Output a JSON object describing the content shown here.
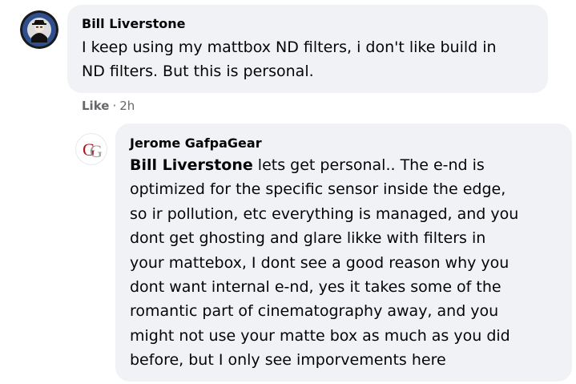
{
  "comment1": {
    "author": "Bill Liverstone",
    "text": "I keep using my mattbox ND filters, i don't like build in\nND filters. But this is personal.",
    "like_label": "Like",
    "separator": "·",
    "time": "2h"
  },
  "reply1": {
    "author": "Jerome GafpaGear",
    "mention": "Bill Liverstone",
    "text": " lets get personal.. The e-nd is\noptimized for the specific sensor inside the edge,\nso ir pollution, etc everything is managed, and you\ndont get ghosting and glare likke with filters in\nyour mattebox, I dont see a good reason why you\ndont want internal e-nd, yes it takes some of the\nromantic part of cinematography away, and you\nmight not use your matte box as much as you did\nbefore, but I only see imporvements here",
    "avatar_letters": "G"
  },
  "colors": {
    "bubble": "#f0f2f5",
    "text": "#050505",
    "meta": "#65676b",
    "logo_red": "#b5121b"
  }
}
